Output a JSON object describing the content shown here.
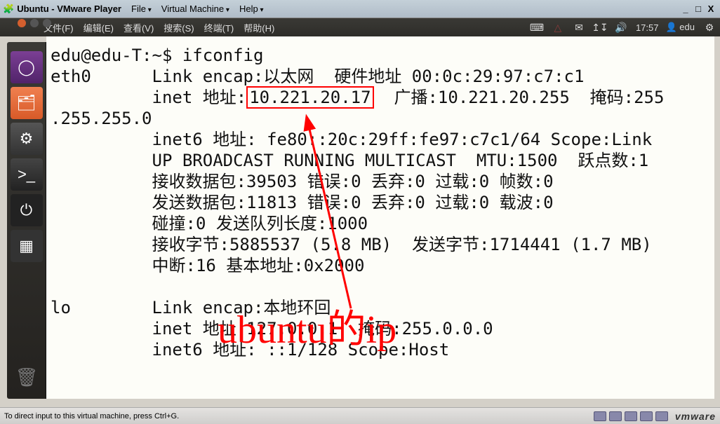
{
  "vmware": {
    "title": "Ubuntu - VMware Player",
    "menu_file": "File",
    "menu_vm": "Virtual Machine",
    "menu_help": "Help",
    "minimize": "_",
    "maximize": "□",
    "close": "X",
    "status_hint": "To direct input to this virtual machine, press Ctrl+G.",
    "brand": "vmware"
  },
  "ubuntu_bar": {
    "file": "文件(F)",
    "edit": "编辑(E)",
    "view": "查看(V)",
    "search": "搜索(S)",
    "terminal": "终端(T)",
    "help": "帮助(H)",
    "time": "17:57",
    "user": "edu"
  },
  "term": {
    "prompt": "edu@edu-T:~$ ",
    "cmd": "ifconfig",
    "eth0_a": "eth0      Link encap:以太网  硬件地址 00:0c:29:97:c7:c1",
    "inet_prefix": "          inet 地址:",
    "ip": "10.221.20.17",
    "inet_suffix": "  广播:10.221.20.255  掩码:255",
    "wrap": ".255.255.0",
    "l4": "          inet6 地址: fe80::20c:29ff:fe97:c7c1/64 Scope:Link",
    "l5": "          UP BROADCAST RUNNING MULTICAST  MTU:1500  跃点数:1",
    "l6": "          接收数据包:39503 错误:0 丢弃:0 过载:0 帧数:0",
    "l7": "          发送数据包:11813 错误:0 丢弃:0 过载:0 载波:0",
    "l8": "          碰撞:0 发送队列长度:1000",
    "l9": "          接收字节:5885537 (5.8 MB)  发送字节:1714441 (1.7 MB)",
    "l10": "          中断:16 基本地址:0x2000",
    "lo1": "lo        Link encap:本地环回",
    "lo2": "          inet 地址:127.0.0.1  掩码:255.0.0.0",
    "lo3": "          inet6 地址: ::1/128 Scope:Host"
  },
  "annotation": {
    "text": "ubuntu的ip"
  }
}
